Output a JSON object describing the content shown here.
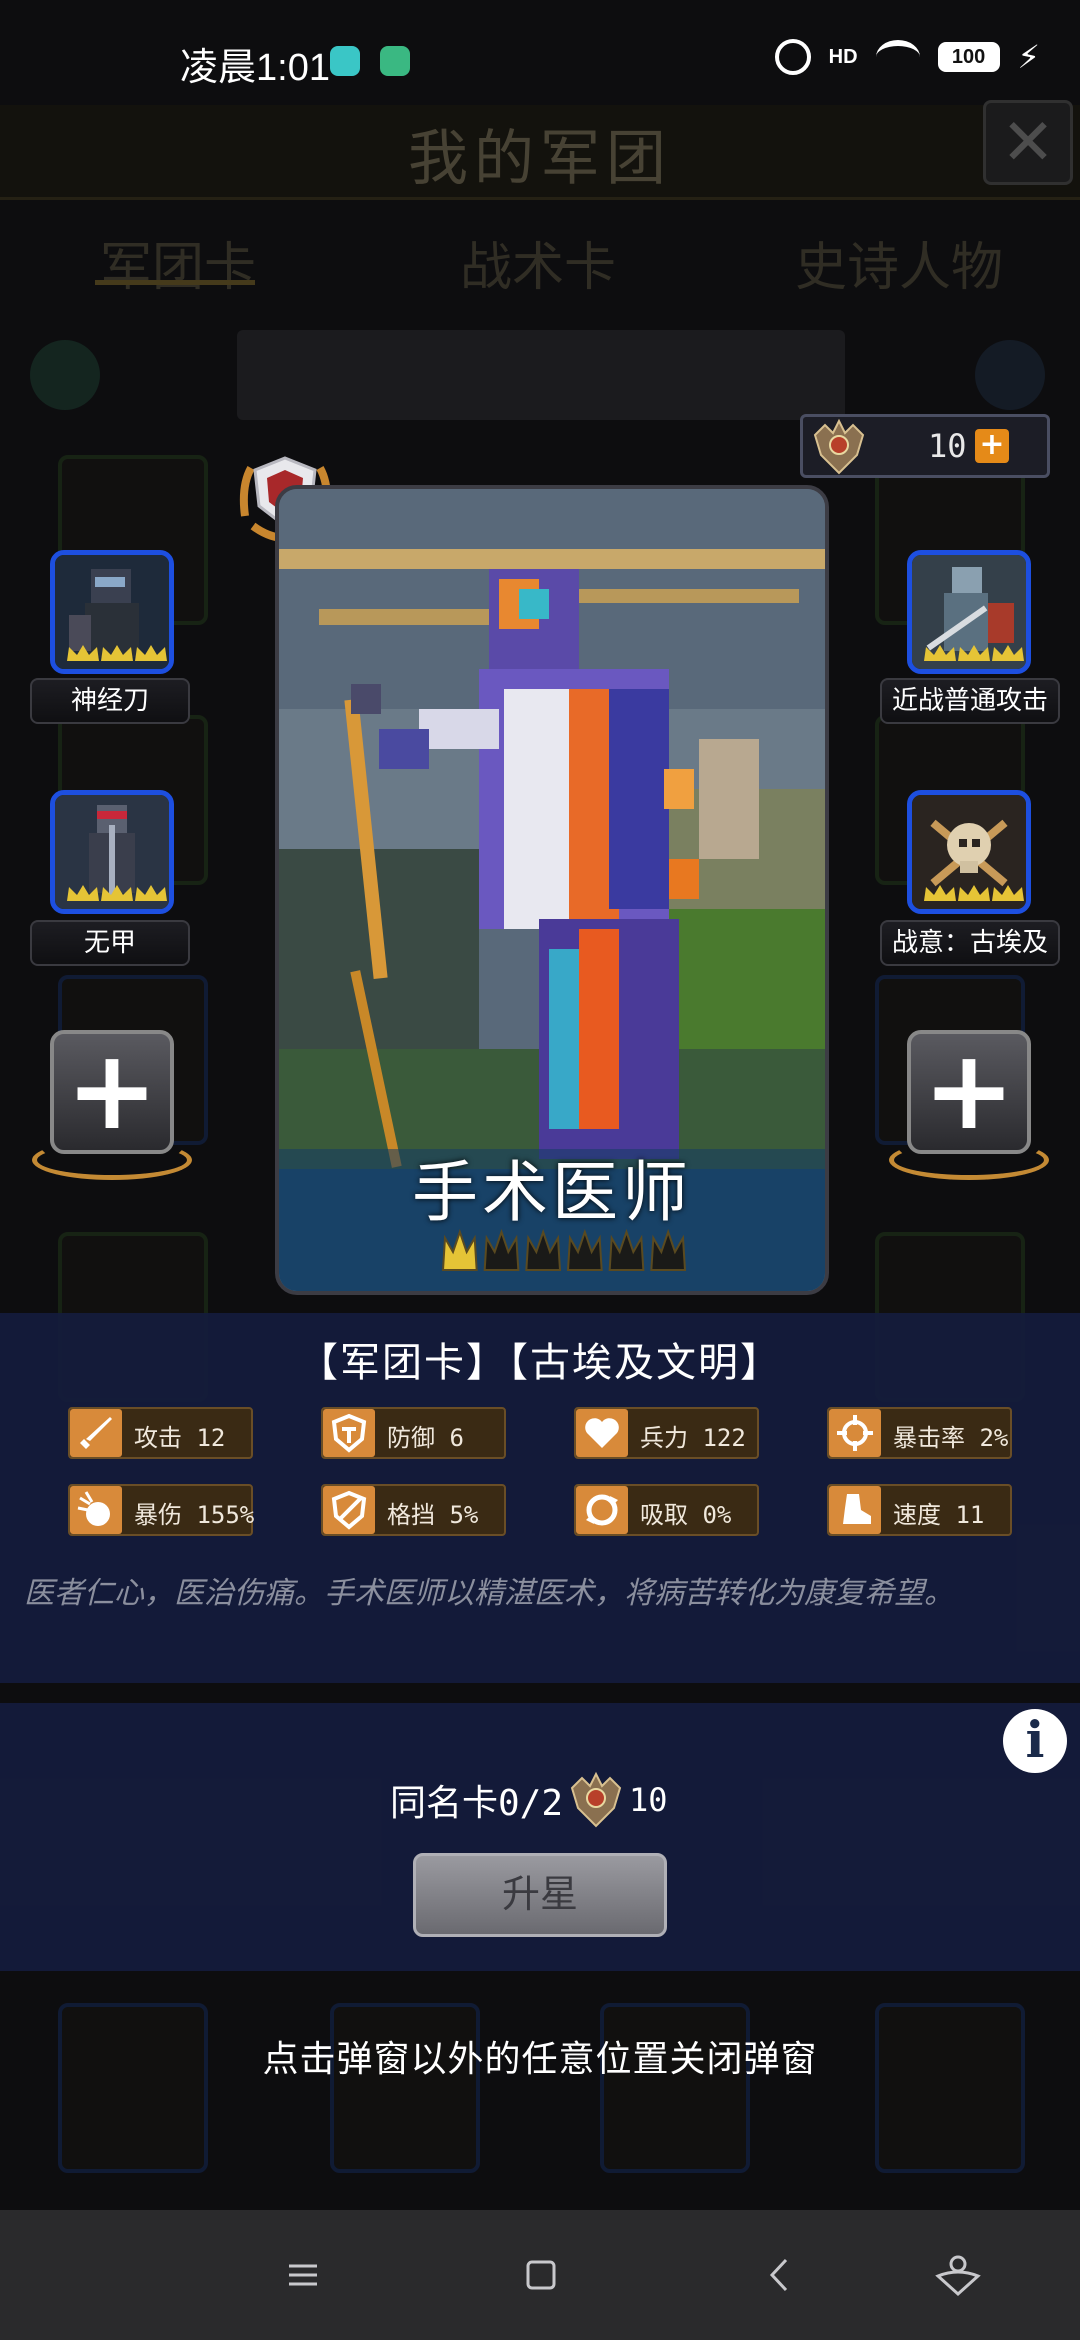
{
  "status_bar": {
    "time": "凌晨1:01",
    "network": "HD",
    "battery": "100"
  },
  "background": {
    "title": "我的军团",
    "tabs": [
      "军团卡",
      "战术卡",
      "史诗人物"
    ]
  },
  "currency": {
    "value": "10",
    "icon": "eagle-emblem-icon",
    "add_icon": "plus-icon"
  },
  "card": {
    "name": "手术医师",
    "stars_filled": 1,
    "stars_total": 6
  },
  "skills_left": [
    {
      "label": "神经刀",
      "icon": "dark-knight-portrait-icon"
    },
    {
      "label": "无甲",
      "icon": "armored-knight-portrait-icon"
    }
  ],
  "skills_right": [
    {
      "label": "近战普通攻击",
      "icon": "sword-warrior-portrait-icon"
    },
    {
      "label": "战意：古埃及",
      "icon": "crossed-skull-icon"
    }
  ],
  "card_tags": "【军团卡】【古埃及文明】",
  "stats": [
    {
      "label": "攻击 12",
      "icon": "sword-icon"
    },
    {
      "label": "防御 6",
      "icon": "shield-icon"
    },
    {
      "label": "兵力 122",
      "icon": "heart-icon"
    },
    {
      "label": "暴击率 2%",
      "icon": "crosshair-icon"
    },
    {
      "label": "暴伤 155%",
      "icon": "burst-icon"
    },
    {
      "label": "格挡 5%",
      "icon": "block-shield-icon"
    },
    {
      "label": "吸取 0%",
      "icon": "lifesteal-icon"
    },
    {
      "label": "速度 11",
      "icon": "boot-icon"
    }
  ],
  "flavor": "医者仁心，医治伤痛。手术医师以精湛医术，将病苦转化为康复希望。",
  "upgrade": {
    "dup_text": "同名卡0/2",
    "cost": "10",
    "button": "升星"
  },
  "close_hint": "点击弹窗以外的任意位置关闭弹窗",
  "colors": {
    "skill_border": "#1d4fe0",
    "stat_bg": "#3a2a14",
    "stat_icon": "#d88a3a",
    "panel_bg": "#141c3c",
    "crown_gold": "#e5c436"
  }
}
